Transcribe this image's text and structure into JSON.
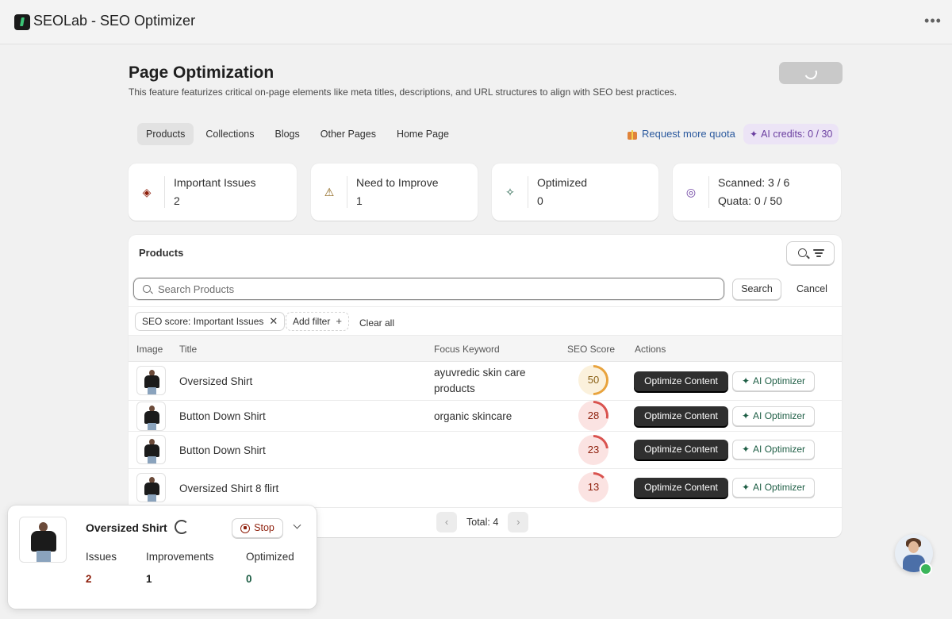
{
  "app": {
    "title": "SEOLab - SEO Optimizer",
    "more_icon": "ellipsis-icon"
  },
  "header": {
    "title": "Page Optimization",
    "subtitle": "This feature featurizes critical on-page elements like meta titles, descriptions, and URL structures to align with SEO best practices."
  },
  "tabs": [
    {
      "label": "Products",
      "active": true
    },
    {
      "label": "Collections",
      "active": false
    },
    {
      "label": "Blogs",
      "active": false
    },
    {
      "label": "Other Pages",
      "active": false
    },
    {
      "label": "Home Page",
      "active": false
    }
  ],
  "quota": {
    "request_label": "Request more quota",
    "credits_label": "AI credits: 0 / 30"
  },
  "stats": [
    {
      "label": "Important Issues",
      "value": "2",
      "icon": "alert-diamond-icon",
      "color": "#8e1f0b"
    },
    {
      "label": "Need to Improve",
      "value": "1",
      "icon": "warning-triangle-icon",
      "color": "#8a6116"
    },
    {
      "label": "Optimized",
      "value": "0",
      "icon": "sparkle-icon",
      "color": "#1e5e45"
    },
    {
      "label": "Scanned: 3 / 6",
      "value": "Quata: 0 / 50",
      "icon": "target-icon",
      "color": "#6b3fa0"
    }
  ],
  "products": {
    "title": "Products",
    "search_placeholder": "Search Products",
    "search_label": "Search",
    "cancel_label": "Cancel",
    "filters": {
      "active_chip": "SEO score: Important Issues",
      "add_filter": "Add filter",
      "clear_all": "Clear all"
    },
    "columns": [
      "Image",
      "Title",
      "Focus Keyword",
      "SEO Score",
      "Actions"
    ],
    "rows": [
      {
        "title": "Oversized Shirt",
        "keyword": "ayuvredic skin care products",
        "score": 50
      },
      {
        "title": "Button Down Shirt",
        "keyword": "organic skincare",
        "score": 28
      },
      {
        "title": "Button Down Shirt",
        "keyword": "",
        "score": 23
      },
      {
        "title": "Oversized Shirt 8 flirt",
        "keyword": "",
        "score": 13
      }
    ],
    "optimize_label": "Optimize Content",
    "ai_label": "AI Optimizer",
    "total_label": "Total: 4"
  },
  "progress_card": {
    "title": "Oversized Shirt",
    "stop_label": "Stop",
    "stats": [
      {
        "label": "Issues",
        "value": "2",
        "color": "#8e1f0b"
      },
      {
        "label": "Improvements",
        "value": "1",
        "color": "#1f1f1f"
      },
      {
        "label": "Optimized",
        "value": "0",
        "color": "#1e5e45"
      }
    ]
  },
  "colors": {
    "score_mid": "#e8a33d",
    "score_low": "#d9534f",
    "accent_purple": "#6b3fa0"
  }
}
